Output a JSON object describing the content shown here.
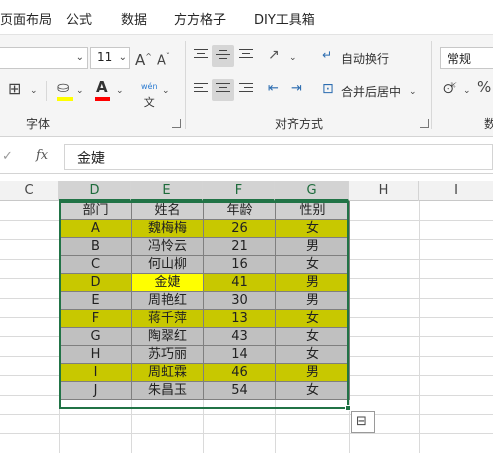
{
  "menu": {
    "tabs": [
      "页面布局",
      "公式",
      "数据",
      "方方格子",
      "DIY工具箱"
    ]
  },
  "ribbon": {
    "font_size": "11",
    "increase_font_label": "A^",
    "decrease_font_label": "Aˇ",
    "phonetic_label": "wén",
    "wrap_text_label": "自动换行",
    "merge_center_label": "合并后居中",
    "number_format": "常规",
    "font_group_label": "字体",
    "align_group_label": "对齐方式",
    "number_group_label": "数",
    "fill_color": "#ffff00",
    "font_color": "#ff0000"
  },
  "formula_bar": {
    "fx_label": "fx",
    "value": "金婕"
  },
  "columns": [
    "C",
    "D",
    "E",
    "F",
    "G",
    "H",
    "I"
  ],
  "table": {
    "headers": [
      "部门",
      "姓名",
      "年龄",
      "性别"
    ],
    "rows": [
      {
        "dept": "A",
        "name": "魏梅梅",
        "age": "26",
        "sex": "女",
        "fill": "#c8c800"
      },
      {
        "dept": "B",
        "name": "冯怜云",
        "age": "21",
        "sex": "男",
        "fill": "#c0c0c0"
      },
      {
        "dept": "C",
        "name": "何山柳",
        "age": "16",
        "sex": "女",
        "fill": "#c0c0c0"
      },
      {
        "dept": "D",
        "name": "金婕",
        "age": "41",
        "sex": "男",
        "fill": "#c8c800"
      },
      {
        "dept": "E",
        "name": "周艳红",
        "age": "30",
        "sex": "男",
        "fill": "#c0c0c0"
      },
      {
        "dept": "F",
        "name": "蒋千萍",
        "age": "13",
        "sex": "女",
        "fill": "#c8c800"
      },
      {
        "dept": "G",
        "name": "陶翠红",
        "age": "43",
        "sex": "女",
        "fill": "#c0c0c0"
      },
      {
        "dept": "H",
        "name": "苏巧丽",
        "age": "14",
        "sex": "女",
        "fill": "#c0c0c0"
      },
      {
        "dept": "I",
        "name": "周虹霖",
        "age": "46",
        "sex": "男",
        "fill": "#c8c800"
      },
      {
        "dept": "J",
        "name": "朱昌玉",
        "age": "54",
        "sex": "女",
        "fill": "#c0c0c0"
      }
    ],
    "active_cell_fill": "#ffff00",
    "active_row": 3
  }
}
